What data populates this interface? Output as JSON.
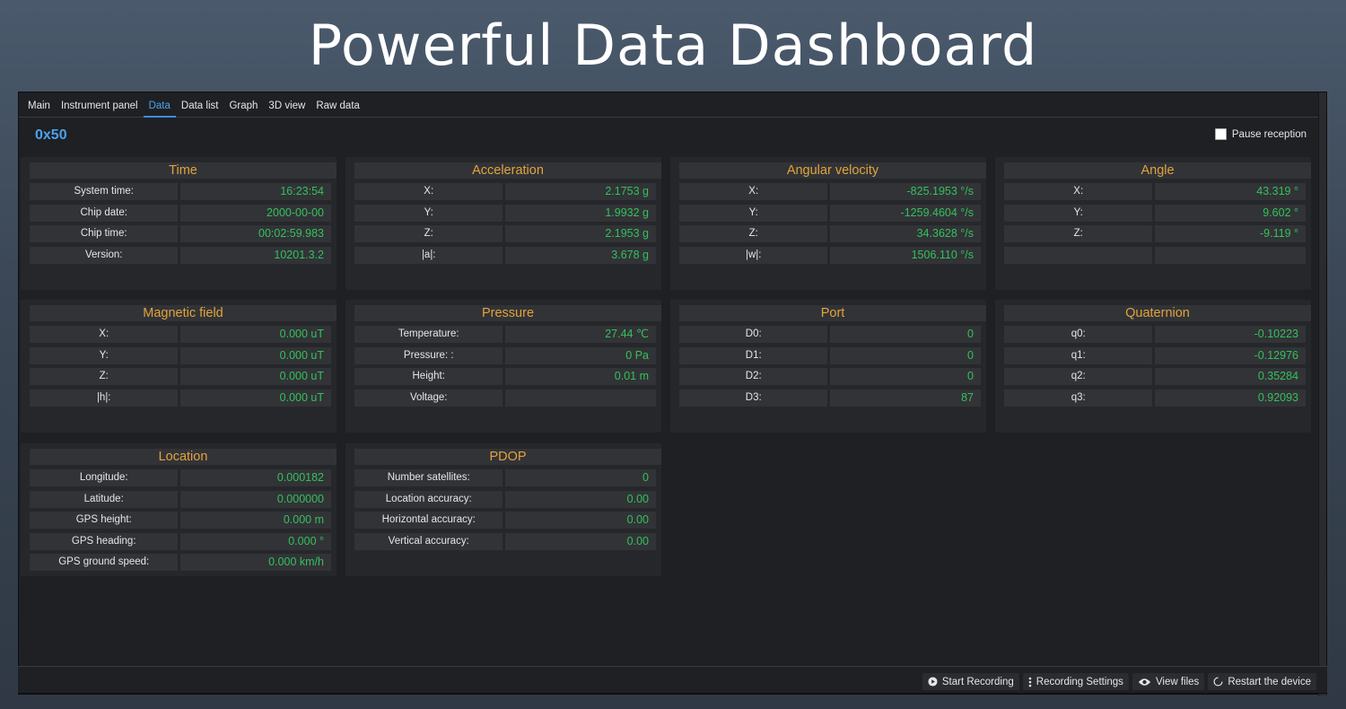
{
  "banner": {
    "title": "Powerful Data Dashboard"
  },
  "tabs": [
    {
      "label": "Main"
    },
    {
      "label": "Instrument panel"
    },
    {
      "label": "Data"
    },
    {
      "label": "Data list"
    },
    {
      "label": "Graph"
    },
    {
      "label": "3D view"
    },
    {
      "label": "Raw data"
    }
  ],
  "device": {
    "id": "0x50"
  },
  "pause": {
    "label": "Pause reception",
    "checked": false
  },
  "panels": {
    "time": {
      "title": "Time",
      "rows": [
        {
          "label": "System time:",
          "value": "16:23:54"
        },
        {
          "label": "Chip date:",
          "value": "2000-00-00"
        },
        {
          "label": "Chip time:",
          "value": "00:02:59.983"
        },
        {
          "label": "Version:",
          "value": "10201.3.2"
        }
      ]
    },
    "acceleration": {
      "title": "Acceleration",
      "rows": [
        {
          "label": "X:",
          "value": "2.1753 g"
        },
        {
          "label": "Y:",
          "value": "1.9932 g"
        },
        {
          "label": "Z:",
          "value": "2.1953 g"
        },
        {
          "label": "|a|:",
          "value": "3.678 g"
        }
      ]
    },
    "angular_velocity": {
      "title": "Angular velocity",
      "rows": [
        {
          "label": "X:",
          "value": "-825.1953 °/s"
        },
        {
          "label": "Y:",
          "value": "-1259.4604 °/s"
        },
        {
          "label": "Z:",
          "value": "34.3628 °/s"
        },
        {
          "label": "|w|:",
          "value": "1506.110 °/s"
        }
      ]
    },
    "angle": {
      "title": "Angle",
      "rows": [
        {
          "label": "X:",
          "value": "43.319 °"
        },
        {
          "label": "Y:",
          "value": "9.602 °"
        },
        {
          "label": "Z:",
          "value": "-9.119 °"
        },
        {
          "label": "",
          "value": ""
        }
      ]
    },
    "magnetic_field": {
      "title": "Magnetic field",
      "rows": [
        {
          "label": "X:",
          "value": "0.000 uT"
        },
        {
          "label": "Y:",
          "value": "0.000 uT"
        },
        {
          "label": "Z:",
          "value": "0.000 uT"
        },
        {
          "label": "|h|:",
          "value": "0.000 uT"
        }
      ]
    },
    "pressure": {
      "title": "Pressure",
      "rows": [
        {
          "label": "Temperature:",
          "value": "27.44 ℃"
        },
        {
          "label": "Pressure: :",
          "value": "0 Pa"
        },
        {
          "label": "Height:",
          "value": "0.01 m"
        },
        {
          "label": "Voltage:",
          "value": ""
        }
      ]
    },
    "port": {
      "title": "Port",
      "rows": [
        {
          "label": "D0:",
          "value": "0"
        },
        {
          "label": "D1:",
          "value": "0"
        },
        {
          "label": "D2:",
          "value": "0"
        },
        {
          "label": "D3:",
          "value": "87"
        }
      ]
    },
    "quaternion": {
      "title": "Quaternion",
      "rows": [
        {
          "label": "q0:",
          "value": "-0.10223"
        },
        {
          "label": "q1:",
          "value": "-0.12976"
        },
        {
          "label": "q2:",
          "value": "0.35284"
        },
        {
          "label": "q3:",
          "value": "0.92093"
        }
      ]
    },
    "location": {
      "title": "Location",
      "rows": [
        {
          "label": "Longitude:",
          "value": "0.000182"
        },
        {
          "label": "Latitude:",
          "value": "0.000000"
        },
        {
          "label": "GPS height:",
          "value": "0.000 m"
        },
        {
          "label": "GPS heading:",
          "value": "0.000 °"
        },
        {
          "label": "GPS ground speed:",
          "value": "0.000 km/h"
        }
      ]
    },
    "pdop": {
      "title": "PDOP",
      "rows": [
        {
          "label": "Number satellites:",
          "value": "0"
        },
        {
          "label": "Location accuracy:",
          "value": "0.00"
        },
        {
          "label": "Horizontal accuracy:",
          "value": "0.00"
        },
        {
          "label": "Vertical accuracy:",
          "value": "0.00"
        }
      ]
    }
  },
  "statusbar": {
    "start_recording": "Start Recording",
    "recording_settings": "Recording Settings",
    "view_files": "View files",
    "restart_device": "Restart the device"
  },
  "icons": {
    "start_recording": "play-circle-icon",
    "recording_settings": "vertical-dots-icon",
    "view_files": "eye-icon",
    "restart_device": "refresh-icon"
  },
  "colors": {
    "accent": "#4aa3f0",
    "panel_title": "#e2a33a",
    "value": "#32c25a",
    "background": "#1f2023"
  }
}
